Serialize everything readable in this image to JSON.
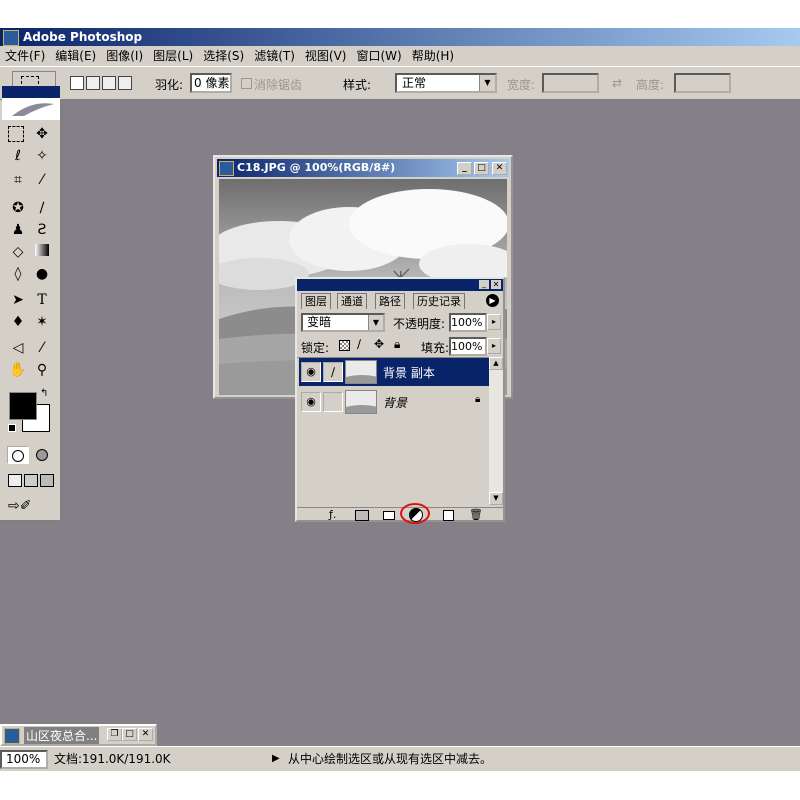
{
  "app": {
    "title": "Adobe Photoshop"
  },
  "menu": [
    "文件(F)",
    "编辑(E)",
    "图像(I)",
    "图层(L)",
    "选择(S)",
    "滤镜(T)",
    "视图(V)",
    "窗口(W)",
    "帮助(H)"
  ],
  "options": {
    "feather_label": "羽化:",
    "feather_value": "0 像素",
    "antialias_label": "消除锯齿",
    "style_label": "样式:",
    "style_value": "正常",
    "width_label": "宽度:",
    "height_label": "高度:",
    "swap_glyph": "⇄"
  },
  "document": {
    "title": "C18.JPG @ 100%(RGB/8#)"
  },
  "layers_panel": {
    "tabs": [
      "图层",
      "通道",
      "路径",
      "历史记录"
    ],
    "blend_mode": "变暗",
    "opacity_label": "不透明度:",
    "opacity_value": "100%",
    "lock_label": "锁定:",
    "fill_label": "填充:",
    "fill_value": "100%",
    "layers": [
      {
        "name": "背景 副本",
        "selected": true
      },
      {
        "name": "背景",
        "selected": false,
        "locked": true
      }
    ],
    "bottom_icons": [
      "layer-style-icon",
      "mask-icon",
      "folder-icon",
      "adjustment-layer-icon",
      "new-layer-icon",
      "trash-icon"
    ],
    "highlight_color": "#e01010"
  },
  "minimized_window": {
    "title": "山区夜总合..."
  },
  "status": {
    "zoom": "100%",
    "doc_info": "文档:191.0K/191.0K",
    "hint": "从中心绘制选区或从现有选区中减去。"
  },
  "colors": {
    "workspace": "#858087",
    "chrome": "#d4d0c8",
    "active_title": "#0a246a"
  }
}
